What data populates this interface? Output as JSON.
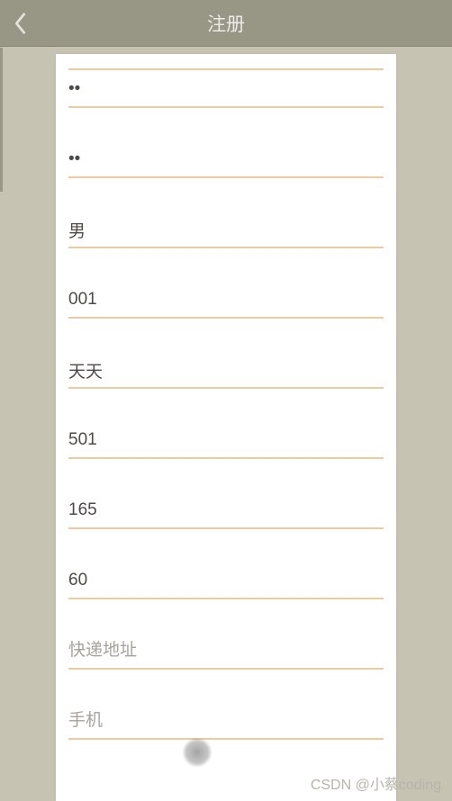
{
  "header": {
    "title": "注册"
  },
  "form": {
    "password1": "••",
    "password2": "••",
    "gender": "男",
    "code": "001",
    "nickname": "天天",
    "room": "501",
    "height": "165",
    "weight": "60",
    "address_placeholder": "快递地址",
    "address_value": "",
    "phone_placeholder": "手机",
    "phone_value": ""
  },
  "watermark": "CSDN @小蔡coding"
}
